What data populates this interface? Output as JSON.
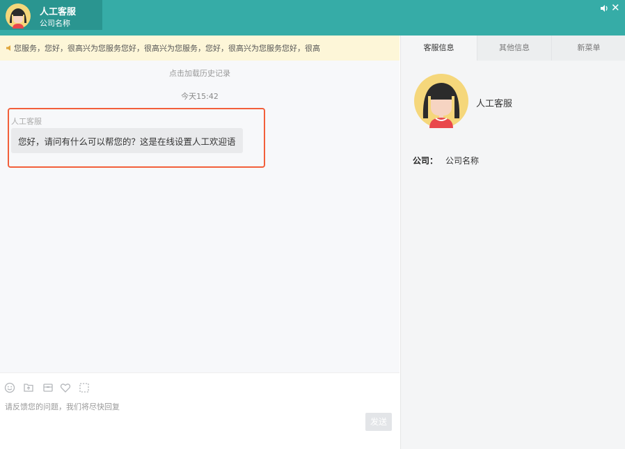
{
  "header": {
    "agent_name": "人工客服",
    "company_name": "公司名称",
    "bg_color": "#36aca7",
    "icons": [
      "avatar",
      "speaker-icon",
      "close-icon"
    ],
    "close_glyph": "✕"
  },
  "chat": {
    "notice": "您服务，您好，很高兴为您服务您好，很高兴为您服务，您好，很高兴为您服务您好，很高",
    "load_history": "点击加载历史记录",
    "timestamp": "今天15:42",
    "message": {
      "sender": "人工客服",
      "text": "您好，请问有什么可以帮您的？这是在线设置人工欢迎语"
    }
  },
  "input": {
    "toolbar_icons": [
      "emoji-icon",
      "file-upload-icon",
      "envelope-icon",
      "heart-icon",
      "screenshot-icon"
    ],
    "placeholder": "请反馈您的问题，我们将尽快回复",
    "send_label": "发送"
  },
  "side_panel": {
    "tabs": [
      {
        "label": "客服信息",
        "active": true
      },
      {
        "label": "其他信息",
        "active": false
      },
      {
        "label": "新菜单",
        "active": false
      }
    ],
    "profile_name": "人工客服",
    "company_label": "公司：",
    "company_value": "公司名称"
  },
  "colors": {
    "header": "#36aca7",
    "agent_block": "#2a9590",
    "notice_bg": "#fdf6d8",
    "highlight_border": "#f25f3a"
  }
}
